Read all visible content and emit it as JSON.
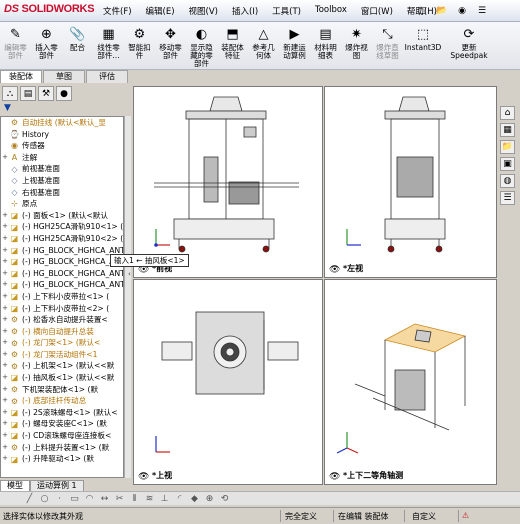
{
  "app": {
    "logo_ds": "DS",
    "logo_sw": "SOLIDWORKS"
  },
  "menu": [
    "文件(F)",
    "编辑(E)",
    "视图(V)",
    "插入(I)",
    "工具(T)",
    "Toolbox",
    "窗口(W)",
    "帮助(H)"
  ],
  "toolbar": [
    {
      "label": "编辑零\n部件",
      "icon": "edit-component-icon",
      "glyph": "✎",
      "disabled": true
    },
    {
      "label": "插入零\n部件",
      "icon": "insert-component-icon",
      "glyph": "⊕",
      "disabled": false
    },
    {
      "label": "配合",
      "icon": "mate-icon",
      "glyph": "📎",
      "disabled": false
    },
    {
      "label": "线性零\n部件...",
      "icon": "linear-pattern-icon",
      "glyph": "▦",
      "disabled": false
    },
    {
      "label": "智能扣\n件",
      "icon": "smart-fastener-icon",
      "glyph": "⚙",
      "disabled": false
    },
    {
      "label": "移动零\n部件",
      "icon": "move-component-icon",
      "glyph": "✥",
      "disabled": false
    },
    {
      "label": "显示隐\n藏的零\n部件",
      "icon": "show-hidden-icon",
      "glyph": "◐",
      "disabled": false
    },
    {
      "label": "装配体\n特征",
      "icon": "assembly-feature-icon",
      "glyph": "⬒",
      "disabled": false
    },
    {
      "label": "参考几\n何体",
      "icon": "reference-geometry-icon",
      "glyph": "△",
      "disabled": false
    },
    {
      "label": "新建运\n动算例",
      "icon": "motion-study-icon",
      "glyph": "▶",
      "disabled": false
    },
    {
      "label": "材料明\n细表",
      "icon": "bom-icon",
      "glyph": "▤",
      "disabled": false
    },
    {
      "label": "爆炸视\n图",
      "icon": "exploded-view-icon",
      "glyph": "✷",
      "disabled": false
    },
    {
      "label": "爆炸直\n线草图",
      "icon": "explode-line-icon",
      "glyph": "⤡",
      "disabled": true
    },
    {
      "label": "Instant3D",
      "icon": "instant3d-icon",
      "glyph": "⬚",
      "disabled": false
    },
    {
      "label": "更新\nSpeedpak",
      "icon": "speedpak-icon",
      "glyph": "⟳",
      "disabled": false
    }
  ],
  "cmd_tabs": [
    "装配体",
    "草图",
    "评估"
  ],
  "tree": [
    {
      "text": "自动挂线  (默认<默认_显",
      "icon": "assembly-icon",
      "exp": "",
      "style": "warnb"
    },
    {
      "text": "History",
      "icon": "history-icon",
      "exp": "",
      "style": ""
    },
    {
      "text": "传感器",
      "icon": "sensor-icon",
      "exp": "",
      "style": ""
    },
    {
      "text": "注解",
      "icon": "annotation-icon",
      "exp": "+",
      "style": ""
    },
    {
      "text": "前视基准面",
      "icon": "plane-icon",
      "exp": "",
      "style": ""
    },
    {
      "text": "上视基准面",
      "icon": "plane-icon",
      "exp": "",
      "style": ""
    },
    {
      "text": "右视基准面",
      "icon": "plane-icon",
      "exp": "",
      "style": ""
    },
    {
      "text": "原点",
      "icon": "origin-icon",
      "exp": "",
      "style": ""
    },
    {
      "text": "(-) 面板<1> (默认<默认",
      "icon": "part-icon",
      "exp": "+",
      "style": ""
    },
    {
      "text": "(-) HGH25CA滑轨910<1> (",
      "icon": "part-icon",
      "exp": "+",
      "style": ""
    },
    {
      "text": "(-) HGH25CA滑轨910<2> (",
      "icon": "part-icon",
      "exp": "+",
      "style": ""
    },
    {
      "text": "(-) HG_BLOCK_HGHCA_ANT_",
      "icon": "part-icon",
      "exp": "+",
      "style": ""
    },
    {
      "text": "(-) HG_BLOCK_HGHCA_ANT_",
      "icon": "part-icon",
      "exp": "+",
      "style": ""
    },
    {
      "text": "(-) HG_BLOCK_HGHCA_ANT_",
      "icon": "part-icon",
      "exp": "+",
      "style": ""
    },
    {
      "text": "(-) HG_BLOCK_HGHCA_ANT_",
      "icon": "part-icon",
      "exp": "+",
      "style": ""
    },
    {
      "text": "(-) 上下料小皮带拉<1> (",
      "icon": "part-icon",
      "exp": "+",
      "style": ""
    },
    {
      "text": "(-) 上下料小皮带拉<2> (",
      "icon": "part-icon",
      "exp": "+",
      "style": ""
    },
    {
      "text": "(-) 松香水自动提升装置<",
      "icon": "subassembly-icon",
      "exp": "+",
      "style": ""
    },
    {
      "text": "(-) 横向自动提升总装",
      "icon": "subassembly-icon",
      "exp": "+",
      "style": "warn"
    },
    {
      "text": "(-) 龙门架<1> (默认<",
      "icon": "subassembly-icon",
      "exp": "+",
      "style": "warn"
    },
    {
      "text": "(-) 龙门架活动组件<1",
      "icon": "subassembly-icon",
      "exp": "+",
      "style": "warn"
    },
    {
      "text": "(-) 上机架<1> (默认<<默",
      "icon": "subassembly-icon",
      "exp": "+",
      "style": ""
    },
    {
      "text": "(-) 抽风板<1> (默认<<默",
      "icon": "part-icon",
      "exp": "+",
      "style": ""
    },
    {
      "text": "下机架装配体<1> (默",
      "icon": "subassembly-icon",
      "exp": "+",
      "style": ""
    },
    {
      "text": "(-) 底部挂杆传动总",
      "icon": "subassembly-icon",
      "exp": "+",
      "style": "warn"
    },
    {
      "text": "(-) 2S滚珠螺母<1> (默认<",
      "icon": "part-icon",
      "exp": "+",
      "style": ""
    },
    {
      "text": "(-) 螺母安装座C<1> (默",
      "icon": "part-icon",
      "exp": "+",
      "style": ""
    },
    {
      "text": "(-) CD滚珠螺母座连接板<",
      "icon": "part-icon",
      "exp": "+",
      "style": ""
    },
    {
      "text": "(-) 上料提升装置<1> (默",
      "icon": "subassembly-icon",
      "exp": "+",
      "style": ""
    },
    {
      "text": "(-) 升降驱动<1> (默",
      "icon": "part-icon",
      "exp": "+",
      "style": ""
    }
  ],
  "left_bottom_tabs": [
    "模型",
    "运动算例 1"
  ],
  "views": {
    "front": "*前视",
    "left": "*左视",
    "top": "*上视",
    "iso": "*上下二等角轴测"
  },
  "tooltip": "输入1  ←  抽风板<1>",
  "status": {
    "message": "选择实体以修改其外观",
    "constraint": "完全定义",
    "mode": "在编辑  装配体",
    "custom": "自定义"
  }
}
